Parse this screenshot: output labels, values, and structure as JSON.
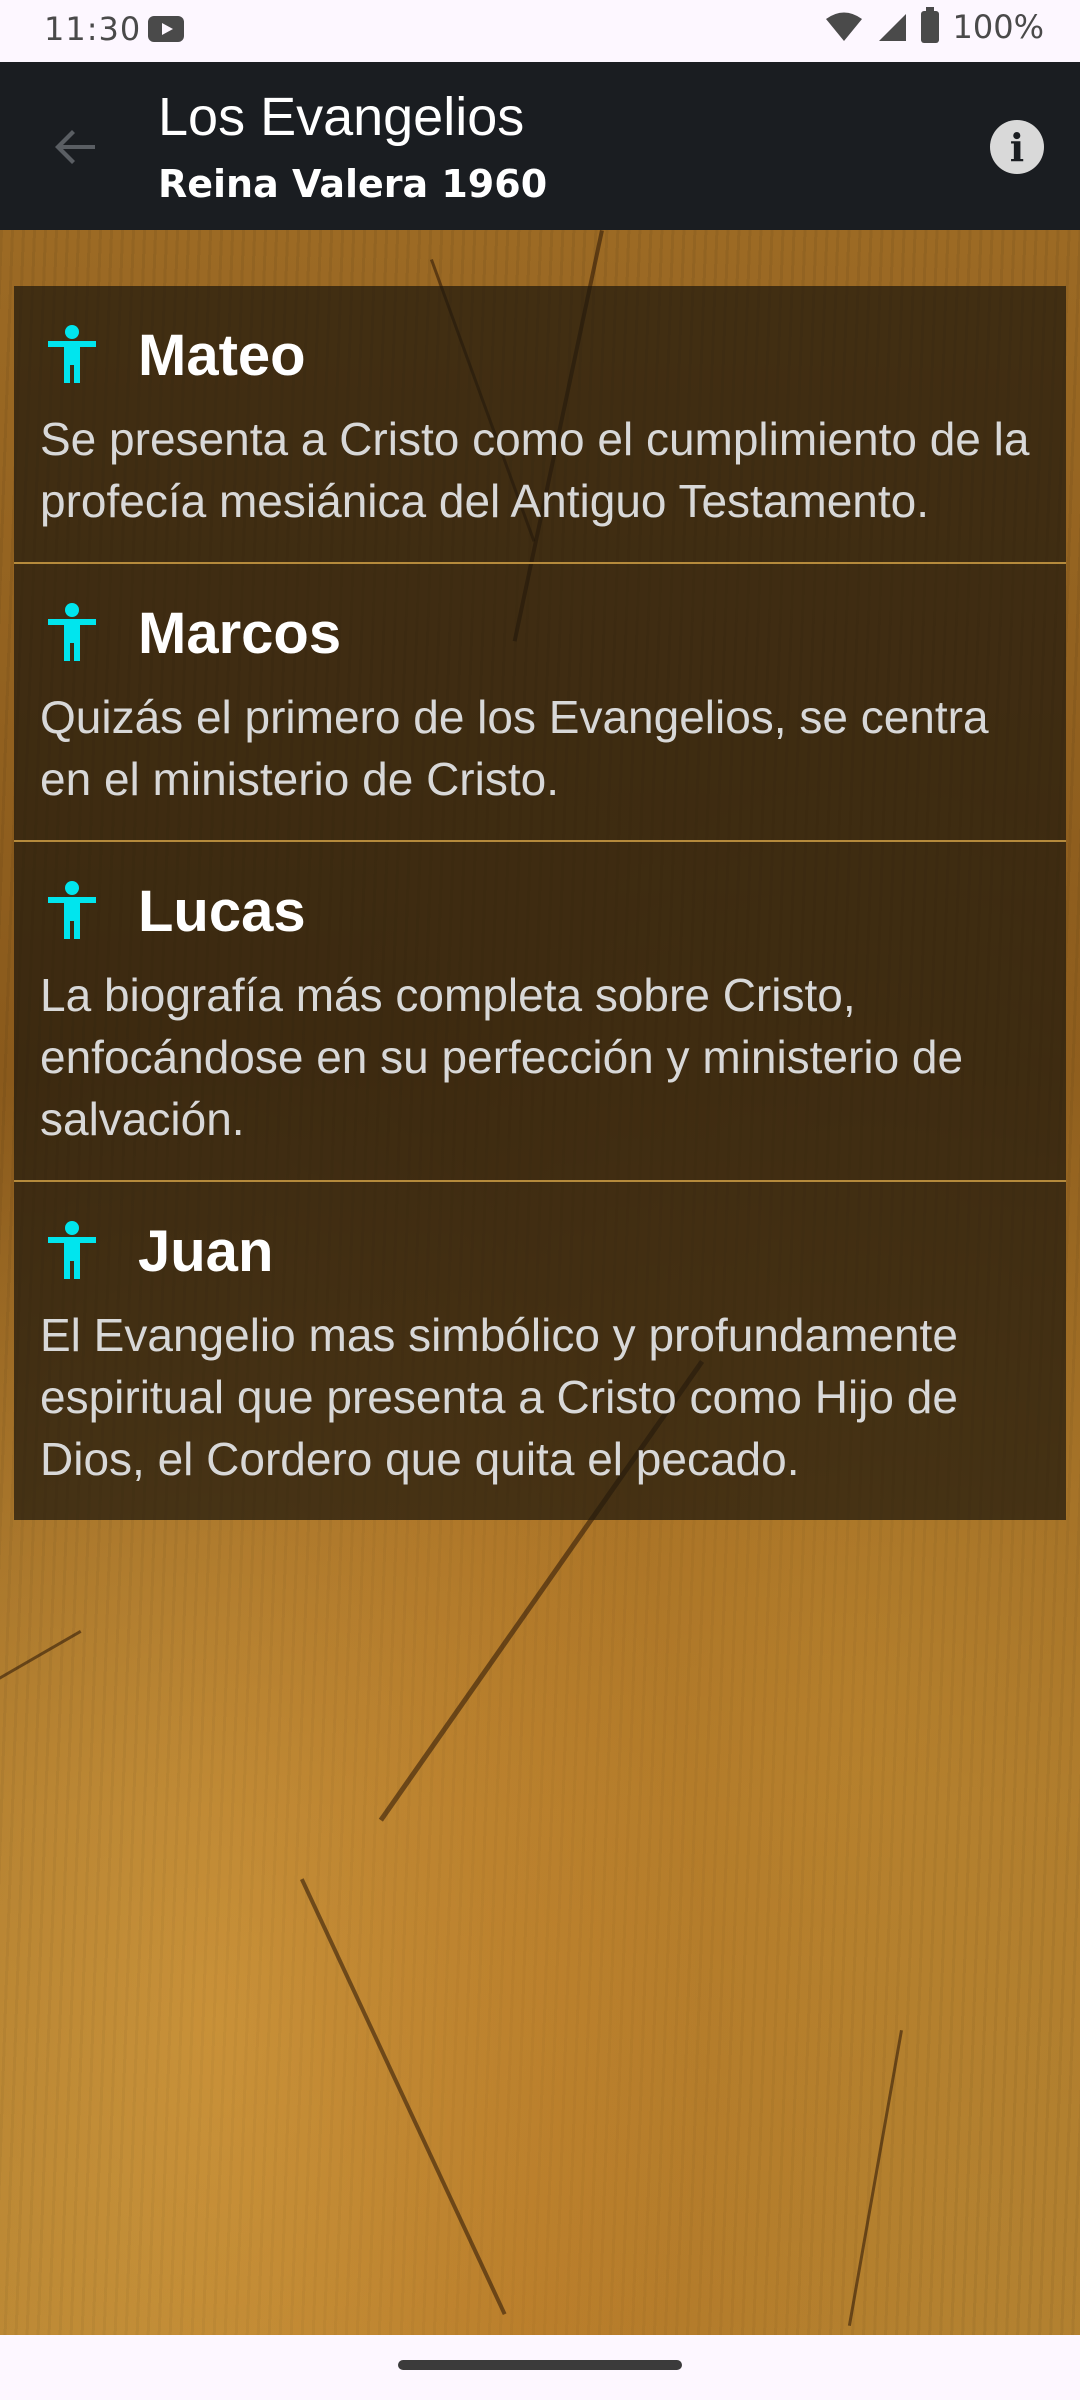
{
  "status_bar": {
    "time": "11:30",
    "battery": "100%"
  },
  "app_bar": {
    "title": "Los Evangelios",
    "subtitle": "Reina Valera 1960",
    "info_glyph": "i",
    "back_icon": "arrow-back-icon"
  },
  "colors": {
    "app_bar_bg": "#1a1d21",
    "icon_accent": "#00e5ee",
    "divider": "#b58a3c",
    "card_bg": "rgba(30,24,12,0.72)"
  },
  "gospels": [
    {
      "title": "Mateo",
      "description": "Se presenta a Cristo como el cumplimiento de la profecía mesiánica del Antiguo Testamento.",
      "icon": "person-icon"
    },
    {
      "title": "Marcos",
      "description": "Quizás el primero de los Evangelios, se centra en el ministerio de Cristo.",
      "icon": "person-icon"
    },
    {
      "title": "Lucas",
      "description": "La biografía más completa sobre Cristo, enfocándose en su perfección y ministerio de salvación.",
      "icon": "person-icon"
    },
    {
      "title": "Juan",
      "description": "El Evangelio mas simbólico y profundamente espiritual que presenta a Cristo como Hijo de Dios, el Cordero que quita el pecado.",
      "icon": "person-icon"
    }
  ]
}
